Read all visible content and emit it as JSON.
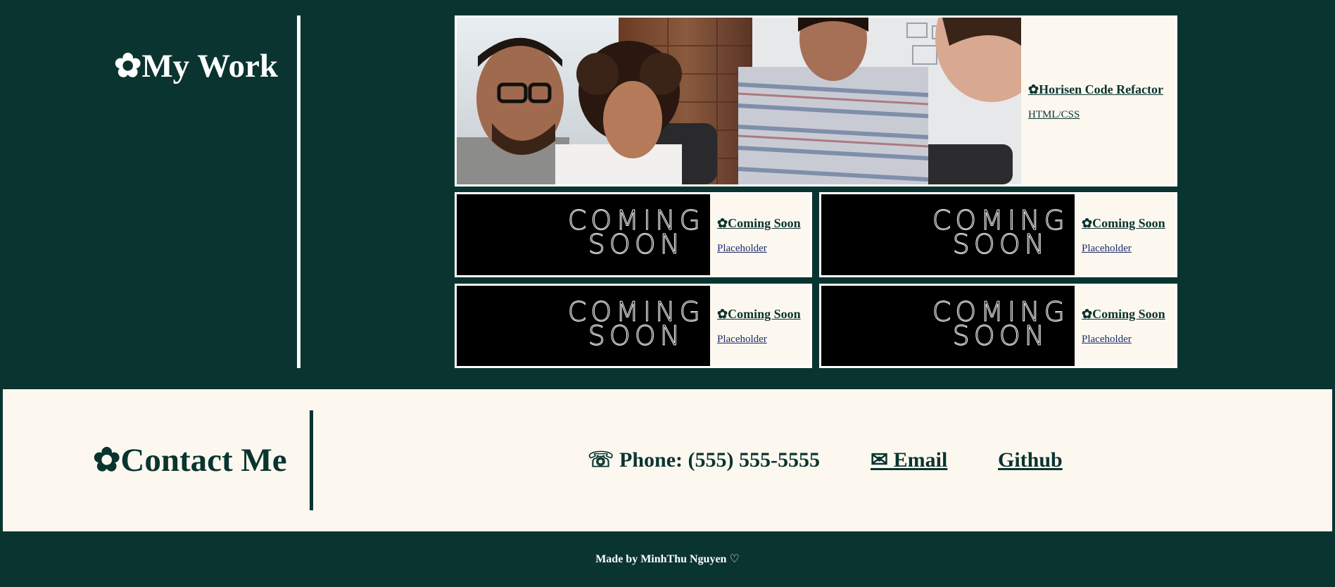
{
  "work": {
    "heading": "✿My Work",
    "featured": {
      "title": "✿Horisen Code Refactor",
      "subtitle": "HTML/CSS",
      "image_alt": "team-photo"
    },
    "projects": [
      {
        "title": "✿Coming Soon",
        "subtitle": "Placeholder",
        "image_line1": "COMING",
        "image_line2": "SOON"
      },
      {
        "title": "✿Coming Soon",
        "subtitle": "Placeholder",
        "image_line1": "COMING",
        "image_line2": "SOON"
      },
      {
        "title": "✿Coming Soon",
        "subtitle": "Placeholder",
        "image_line1": "COMING",
        "image_line2": "SOON"
      },
      {
        "title": "✿Coming Soon",
        "subtitle": "Placeholder",
        "image_line1": "COMING",
        "image_line2": "SOON"
      }
    ]
  },
  "contact": {
    "heading": "✿Contact Me",
    "phone": "☏ Phone: (555) 555-5555",
    "email": "✉ Email",
    "github": "Github"
  },
  "footer": {
    "text": "Made by MinhThu Nguyen ♡"
  },
  "colors": {
    "primary": "#0a3430",
    "cream": "#fdf8ef",
    "white": "#ffffff"
  }
}
